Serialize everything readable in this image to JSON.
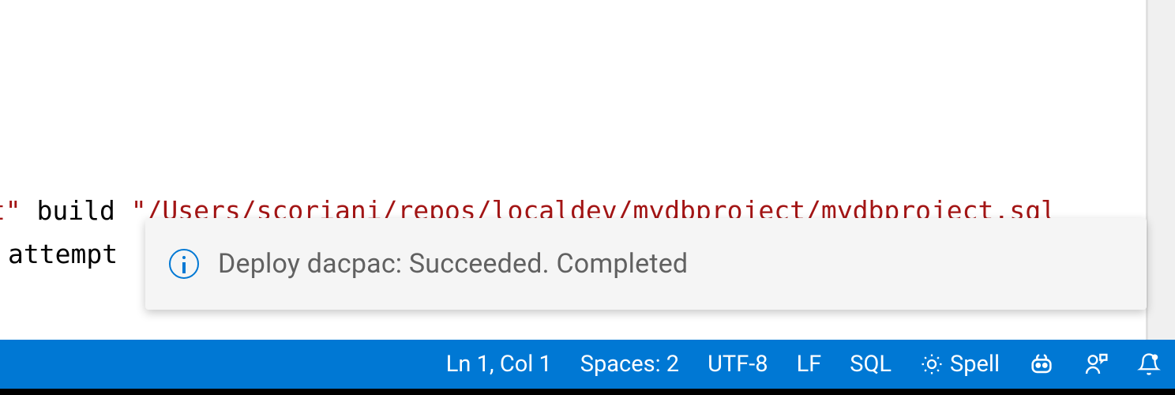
{
  "editor": {
    "line1_part1": "et\"",
    "line1_part2": "  build ",
    "line1_part3": "\"/Users/scoriani/repos/localdev/mydbproject/mydbproject.sql",
    "line2": " attempt"
  },
  "notification": {
    "message": "Deploy dacpac: Succeeded. Completed"
  },
  "statusBar": {
    "cursor": "Ln 1, Col 1",
    "indentation": "Spaces: 2",
    "encoding": "UTF-8",
    "eol": "LF",
    "language": "SQL",
    "spell": "Spell"
  }
}
